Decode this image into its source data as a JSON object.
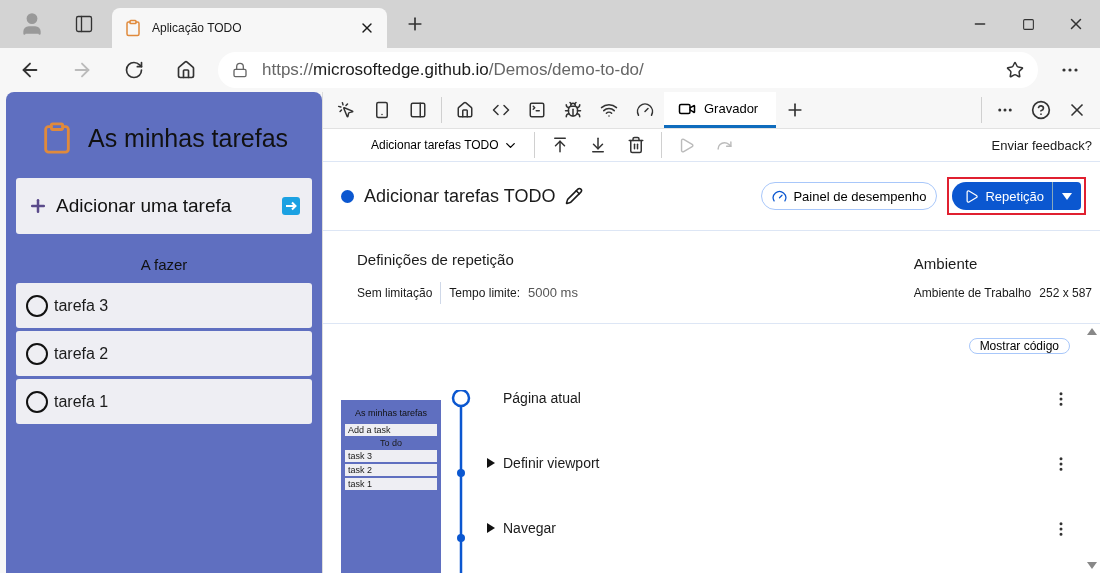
{
  "browser": {
    "tab_title": "Aplicação TODO",
    "url_scheme": "https://",
    "url_host": "microsoftedge.github.io",
    "url_path": "/Demos/demo-to-do/"
  },
  "app": {
    "title": "As minhas tarefas",
    "add_label": "Adicionar uma tarefa",
    "section": "A fazer",
    "tasks": [
      {
        "label": "tarefa 3",
        "done": false
      },
      {
        "label": "tarefa 2",
        "done": false
      },
      {
        "label": "tarefa 1",
        "done": false
      }
    ]
  },
  "devtools": {
    "tabs": [
      {
        "label": "Gravador",
        "selected": true
      }
    ]
  },
  "recorder": {
    "recording": "Adicionar tarefas TODO",
    "feedback": "Enviar feedback?",
    "title": "Adicionar tarefas TODO",
    "perf_button": "Painel de desempenho",
    "replay_button": "Repetição",
    "replay_settings": {
      "heading": "Definições de repetição",
      "throttling": "Sem limitação",
      "timeout_label": "Tempo limite:",
      "timeout_value": "5000 ms"
    },
    "environment": {
      "heading": "Ambiente",
      "device": "Ambiente de Trabalho",
      "size": "252 x 587"
    },
    "show_code": "Mostrar código",
    "thumbnail": {
      "title": "As minhas tarefas",
      "add": "Add a task",
      "section": "To do",
      "tasks": [
        "task 3",
        "task 2",
        "task 1"
      ]
    },
    "steps": [
      {
        "label": "Página atual",
        "kind": "current"
      },
      {
        "label": "Definir viewport",
        "kind": "step"
      },
      {
        "label": "Navegar",
        "kind": "step"
      }
    ]
  }
}
